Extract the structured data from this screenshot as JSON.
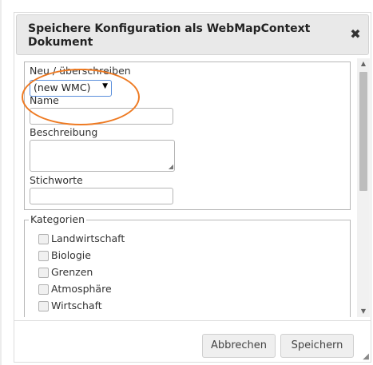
{
  "dialog": {
    "title": "Speichere Konfiguration als WebMapContext Dokument",
    "close_icon": "close-icon"
  },
  "form": {
    "mode_label": "Neu / überschreiben",
    "mode_select": {
      "selected": "(new WMC)"
    },
    "name_label": "Name",
    "name_value": "",
    "description_label": "Beschreibung",
    "description_value": "",
    "keywords_label": "Stichworte",
    "keywords_value": ""
  },
  "categories": {
    "legend": "Kategorien",
    "items": [
      {
        "label": "Landwirtschaft",
        "checked": false
      },
      {
        "label": "Biologie",
        "checked": false
      },
      {
        "label": "Grenzen",
        "checked": false
      },
      {
        "label": "Atmosphäre",
        "checked": false
      },
      {
        "label": "Wirtschaft",
        "checked": false
      }
    ]
  },
  "buttons": {
    "cancel_label": "Abbrechen",
    "save_label": "Speichern"
  },
  "colors": {
    "annotation": "#ee7a22",
    "select_border": "#5b8fdc"
  }
}
